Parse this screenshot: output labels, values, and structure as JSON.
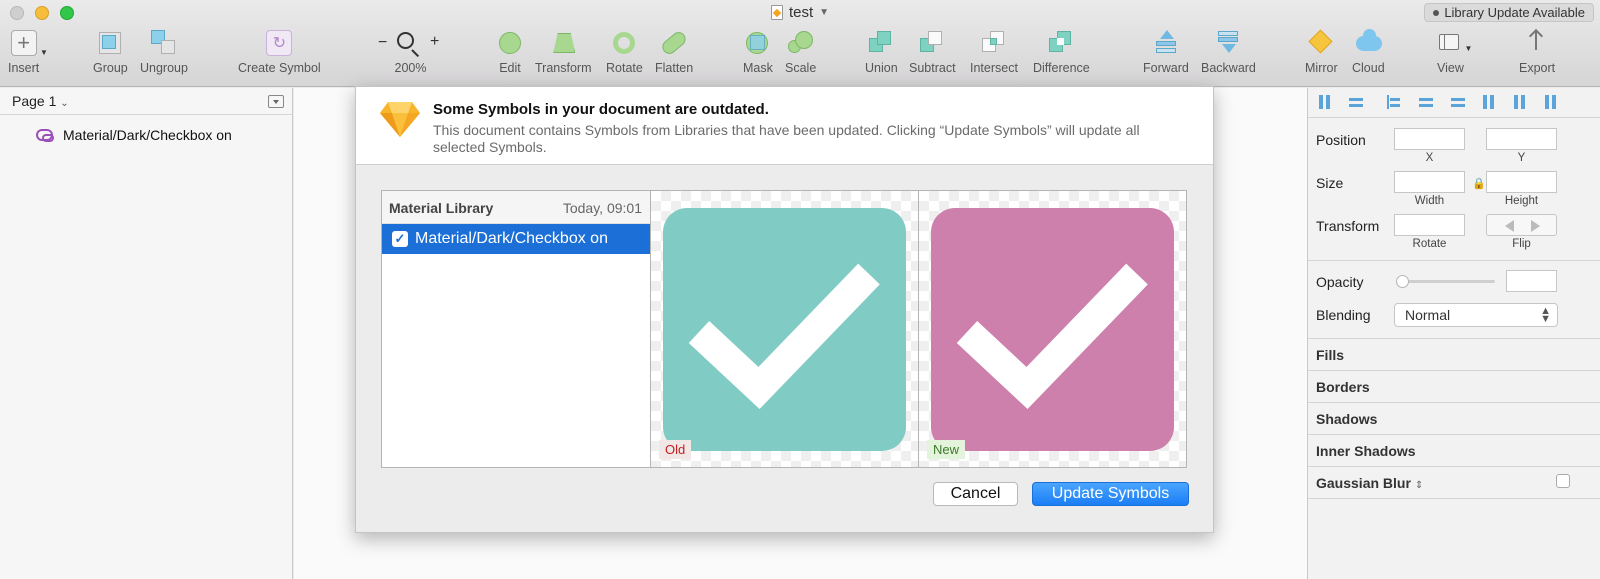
{
  "window": {
    "title": "test",
    "library_notice": "Library Update Available"
  },
  "toolbar": {
    "insert": "Insert",
    "group": "Group",
    "ungroup": "Ungroup",
    "create_symbol": "Create Symbol",
    "zoom_minus": "−",
    "zoom_plus": "+",
    "zoom_level": "200%",
    "edit": "Edit",
    "transform": "Transform",
    "rotate": "Rotate",
    "flatten": "Flatten",
    "mask": "Mask",
    "scale": "Scale",
    "union": "Union",
    "subtract": "Subtract",
    "intersect": "Intersect",
    "difference": "Difference",
    "forward": "Forward",
    "backward": "Backward",
    "mirror": "Mirror",
    "cloud": "Cloud",
    "view": "View",
    "export": "Export"
  },
  "left_panel": {
    "page_selector": "Page 1",
    "layers": [
      {
        "name": "Material/Dark/Checkbox on",
        "icon": "symbol-icon"
      }
    ]
  },
  "dialog": {
    "title": "Some Symbols in your document are outdated.",
    "message": "This document contains Symbols from Libraries that have been updated. Clicking “Update Symbols” will update all selected Symbols.",
    "library": {
      "name": "Material Library",
      "date": "Today, 09:01",
      "items": [
        {
          "label": "Material/Dark/Checkbox on",
          "checked": true
        }
      ]
    },
    "preview_old": {
      "tag": "Old",
      "color": "#80cbc4"
    },
    "preview_new": {
      "tag": "New",
      "color": "#cc80ab"
    },
    "cancel_label": "Cancel",
    "update_label": "Update Symbols"
  },
  "inspector": {
    "position_label": "Position",
    "x_label": "X",
    "y_label": "Y",
    "size_label": "Size",
    "width_label": "Width",
    "height_label": "Height",
    "transform_label": "Transform",
    "rotate_label": "Rotate",
    "flip_label": "Flip",
    "opacity_label": "Opacity",
    "blending_label": "Blending",
    "blending_value": "Normal",
    "sections": [
      "Fills",
      "Borders",
      "Shadows",
      "Inner Shadows",
      "Gaussian Blur"
    ]
  },
  "colors": {
    "accent": "#1b6fd6",
    "old_tag": "#c42020",
    "new_tag": "#3d7a2a"
  }
}
